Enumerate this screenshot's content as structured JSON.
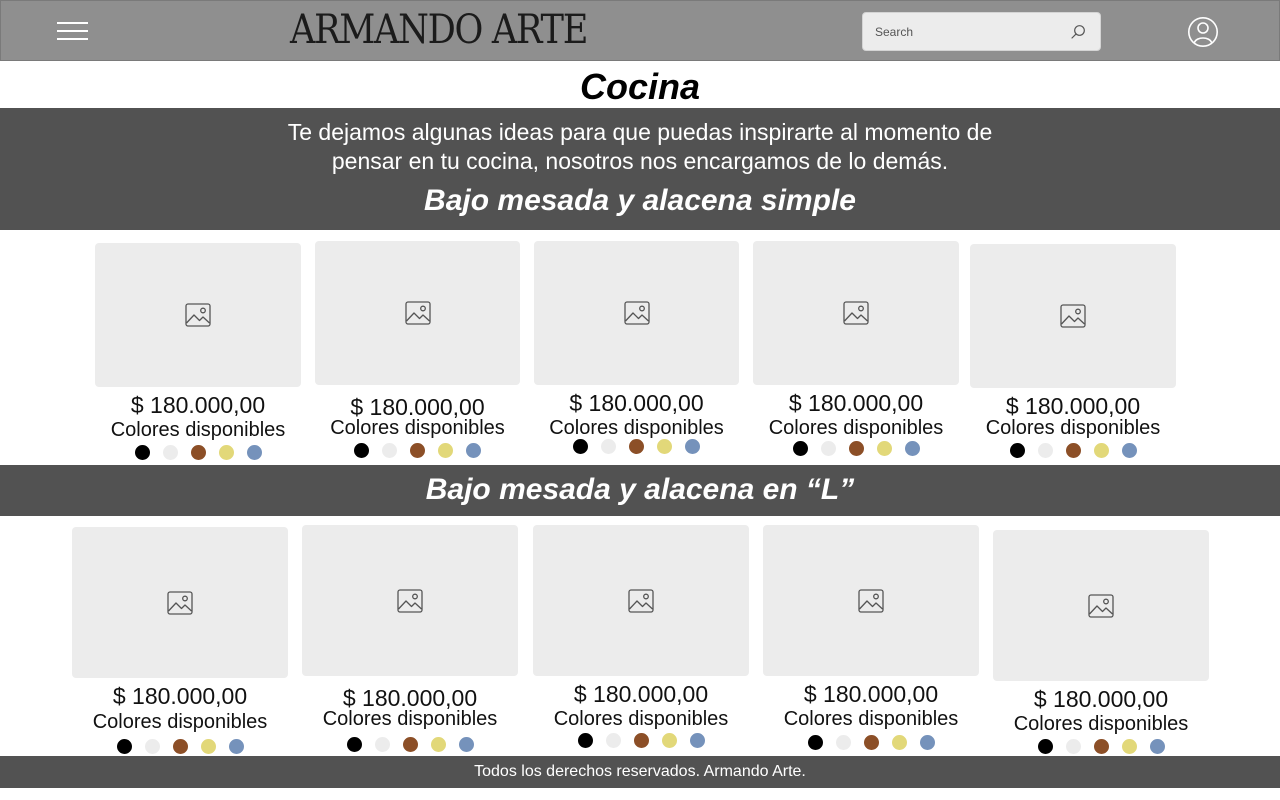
{
  "header": {
    "logo": "ARMANDO ARTE",
    "search_placeholder": "Search"
  },
  "page_title": "Cocina",
  "intro": {
    "line1": "Te dejamos algunas ideas para que puedas inspirarte al momento de",
    "line2": "pensar en tu cocina, nosotros nos encargamos de lo demás."
  },
  "sections": [
    {
      "title": "Bajo mesada y alacena simple",
      "products": [
        {
          "price": "$ 180.000,00",
          "colors_label": "Colores disponibles"
        },
        {
          "price": "$ 180.000,00",
          "colors_label": "Colores disponibles"
        },
        {
          "price": "$ 180.000,00",
          "colors_label": "Colores disponibles"
        },
        {
          "price": "$ 180.000,00",
          "colors_label": "Colores disponibles"
        },
        {
          "price": "$ 180.000,00",
          "colors_label": "Colores disponibles"
        }
      ]
    },
    {
      "title": "Bajo mesada y alacena en “L”",
      "products": [
        {
          "price": "$ 180.000,00",
          "colors_label": "Colores disponibles"
        },
        {
          "price": "$ 180.000,00",
          "colors_label": "Colores disponibles"
        },
        {
          "price": "$ 180.000,00",
          "colors_label": "Colores disponibles"
        },
        {
          "price": "$ 180.000,00",
          "colors_label": "Colores disponibles"
        },
        {
          "price": "$ 180.000,00",
          "colors_label": "Colores disponibles"
        }
      ]
    }
  ],
  "swatch_colors": [
    "#000000",
    "#ececec",
    "#8c4f27",
    "#e2d879",
    "#7592bb"
  ],
  "icons": {
    "menu": "hamburger-menu-icon",
    "search": "search-icon",
    "user": "user-account-icon",
    "image_placeholder": "image-placeholder-icon"
  },
  "colors": {
    "header_bg": "#8f8f8f",
    "band_bg": "#525252",
    "card_bg": "#ececec"
  },
  "footer": {
    "text": "Todos los derechos reservados. Armando Arte."
  }
}
